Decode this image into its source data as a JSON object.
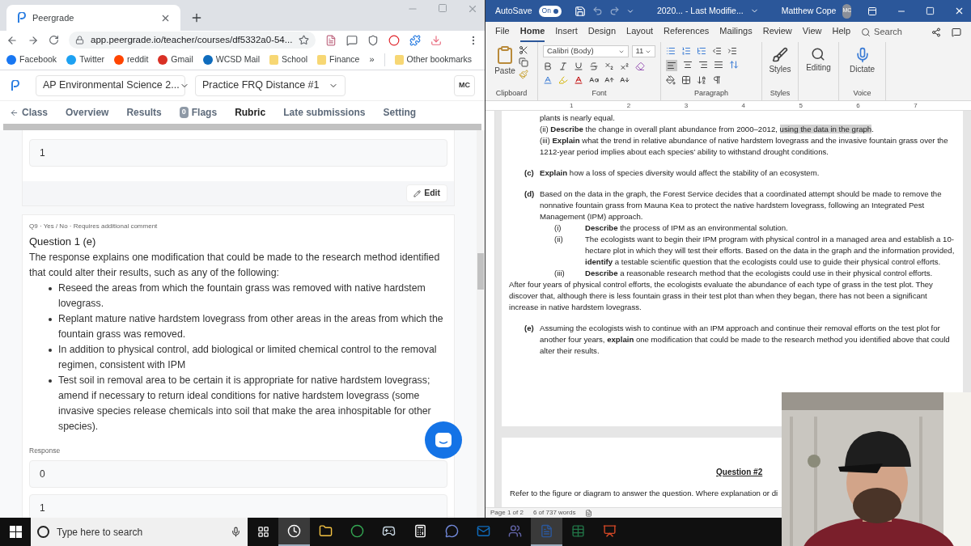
{
  "browser": {
    "tab_title": "Peergrade",
    "url": "app.peergrade.io/teacher/courses/df5332a0-54...",
    "bookmarks": [
      {
        "kind": "site",
        "label": "Facebook",
        "color": "#1877f2"
      },
      {
        "kind": "site",
        "label": "Twitter",
        "color": "#1da1f2"
      },
      {
        "kind": "site",
        "label": "reddit",
        "color": "#ff4500"
      },
      {
        "kind": "site",
        "label": "Gmail",
        "color": "#d93025"
      },
      {
        "kind": "site",
        "label": "WCSD Mail",
        "color": "#0f6cbd"
      },
      {
        "kind": "folder",
        "label": "School",
        "color": "#f7d774"
      },
      {
        "kind": "folder",
        "label": "Finance",
        "color": "#f7d774"
      }
    ],
    "more": "»",
    "other_bookmarks": "Other bookmarks"
  },
  "app": {
    "course": "AP Environmental Science 2...",
    "assignment": "Practice FRQ Distance #1",
    "avatar": "MC",
    "nav": [
      {
        "label": "Class",
        "kind": "back",
        "selected": false
      },
      {
        "label": "Overview",
        "kind": "plain",
        "selected": false
      },
      {
        "label": "Results",
        "kind": "plain",
        "selected": false
      },
      {
        "label": "Flags",
        "kind": "badge",
        "badge": "0",
        "selected": false
      },
      {
        "label": "Rubric",
        "kind": "plain",
        "selected": true
      },
      {
        "label": "Late submissions",
        "kind": "plain",
        "selected": false
      },
      {
        "label": "Setting",
        "kind": "plain",
        "selected": false
      }
    ],
    "previous_card": {
      "option": "1",
      "edit": "Edit"
    },
    "question": {
      "meta": "Q9 · Yes / No · Requires additional comment",
      "title": "Question 1 (e)",
      "description": "The response explains one modification that could be made to the research method identified that could alter their results, such as any of the following:",
      "bullets": [
        "Reseed the areas from which the fountain grass was removed with native hardstem lovegrass.",
        "Replant mature native hardstem lovegrass from other areas in the areas from which the fountain grass was removed.",
        "In addition to physical control, add biological or limited chemical control to the removal regimen, consistent with IPM",
        "Test soil in removal area to be certain it is appropriate for native hardstem lovegrass; amend if necessary to return ideal conditions for native hardstem lovegrass (some invasive species release chemicals into soil that make the area inhospitable for other species)."
      ],
      "response_label": "Response",
      "options": [
        "0",
        "1"
      ]
    }
  },
  "word": {
    "autosave": "AutoSave",
    "autosave_toggle": {
      "label": "On",
      "on": true
    },
    "title": "2020... - Last Modifie...",
    "user": "Matthew Cope",
    "initials": "MC",
    "menu": [
      {
        "label": "File",
        "selected": false
      },
      {
        "label": "Home",
        "selected": true
      },
      {
        "label": "Insert",
        "selected": false
      },
      {
        "label": "Design",
        "selected": false
      },
      {
        "label": "Layout",
        "selected": false
      },
      {
        "label": "References",
        "selected": false
      },
      {
        "label": "Mailings",
        "selected": false
      },
      {
        "label": "Review",
        "selected": false
      },
      {
        "label": "View",
        "selected": false
      },
      {
        "label": "Help",
        "selected": false
      }
    ],
    "search": "Search",
    "ribbon": {
      "paste": "Paste",
      "font": "Calibri (Body)",
      "size": "11",
      "styles": "Styles",
      "editing": "Editing",
      "dictate": "Dictate",
      "groups": [
        "Clipboard",
        "Font",
        "Paragraph",
        "Styles",
        "Voice"
      ]
    },
    "ruler": [
      "1",
      "2",
      "3",
      "4",
      "5",
      "6",
      "7"
    ],
    "paragraphs": [
      {
        "kind": "continuation",
        "text": "plants is nearly equal."
      },
      {
        "kind": "continuation",
        "text": "(ii) **Describe** the change in overall plant abundance from 2000–2012, ",
        "highlight": "using the data in the graph",
        "after": "."
      },
      {
        "kind": "continuation",
        "text": "(iii) **Explain** what the trend in relative abundance of native hardstem lovegrass and the invasive fountain grass over the 1212-year period implies about each species’ ability to withstand drought conditions."
      },
      {
        "kind": "lettered",
        "label": "(c)",
        "text": "**Explain** how a loss of species diversity would affect the stability of an ecosystem."
      },
      {
        "kind": "lettered",
        "label": "(d)",
        "text": "Based on the data in the graph, the Forest Service decides that a coordinated attempt should be made to remove the nonnative fountain grass from Mauna Kea to protect the native hardstem lovegrass, following an Integrated Pest Management (IPM) approach."
      },
      {
        "kind": "roman",
        "label": "(i)",
        "text": "**Describe** the process of IPM as an environmental solution."
      },
      {
        "kind": "roman",
        "label": "(ii)",
        "text": "The ecologists want to begin their IPM program with physical control in a managed area and establish a 10-hectare plot in which they will test their efforts. Based on the data in the graph and the information provided, **identify** a testable scientific question that the ecologists could use to guide their physical control efforts."
      },
      {
        "kind": "roman",
        "label": "(iii)",
        "text": "**Describe** a reasonable research method that the ecologists could use in their physical control efforts."
      },
      {
        "kind": "plain",
        "text": "After four years of physical control efforts, the ecologists evaluate the abundance of each type of grass in the test plot. They discover that, although there is less fountain grass in their test plot than when they began, there has not been a significant increase in native hardstem lovegrass."
      },
      {
        "kind": "lettered",
        "label": "(e)",
        "text": "Assuming the ecologists wish to continue with an IPM approach and continue their removal efforts on the test plot for another four years, **explain** one modification that could be made to the research method you identified above that could alter their results."
      }
    ],
    "page2": {
      "heading": "Question #2",
      "text": "Refer to the figure or diagram to answer the question. Where explanation or di"
    },
    "status": {
      "page": "Page 1 of 2",
      "words": "6 of 737 words"
    }
  },
  "taskbar": {
    "search_placeholder": "Type here to search",
    "apps": [
      {
        "kind": "clock",
        "active": true
      },
      {
        "kind": "folder",
        "active": false
      },
      {
        "kind": "chrome",
        "active": false
      },
      {
        "kind": "steam",
        "active": false
      },
      {
        "kind": "calculator",
        "active": false
      },
      {
        "kind": "chat",
        "active": false
      },
      {
        "kind": "outlook",
        "active": false
      },
      {
        "kind": "teams",
        "active": false
      },
      {
        "kind": "word",
        "active": true
      },
      {
        "kind": "excel",
        "active": false
      },
      {
        "kind": "powerpoint",
        "active": false
      }
    ]
  }
}
